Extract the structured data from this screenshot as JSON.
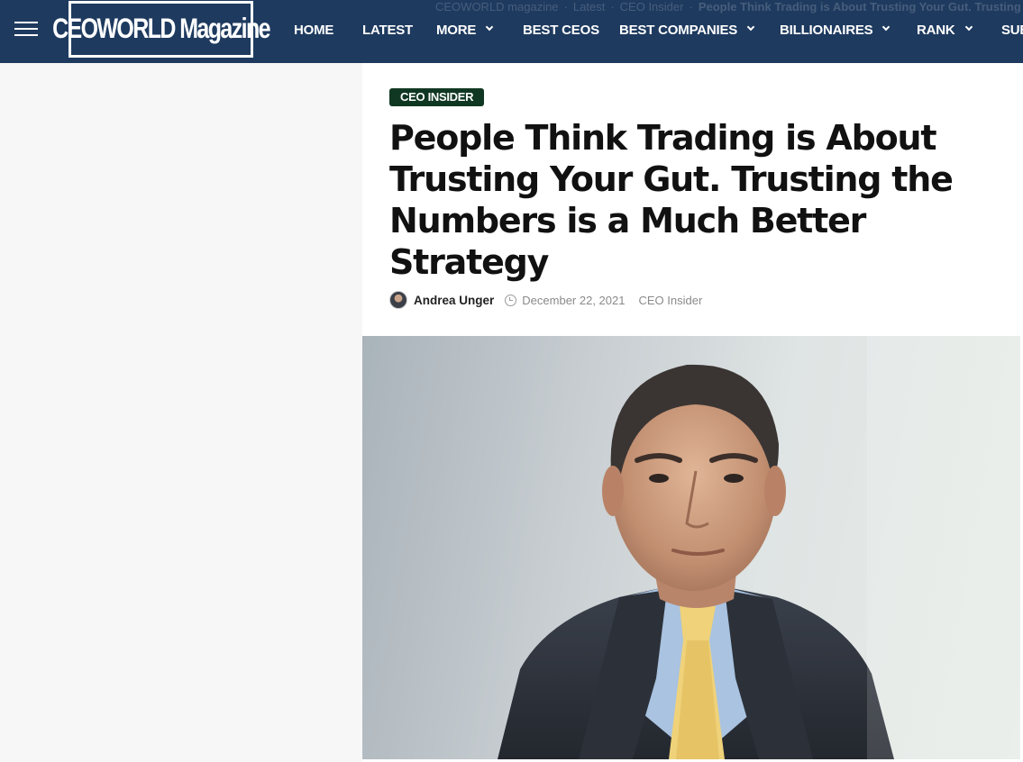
{
  "breadcrumb": {
    "items": [
      "CEOWORLD magazine",
      "Latest",
      "CEO Insider"
    ],
    "separator": "·",
    "current": "People Think Trading is About Trusting Your Gut. Trusting the Numbers is a Much Better Strategy"
  },
  "header": {
    "logo_text": "CEOWORLD Magazine",
    "nav": [
      {
        "label": "HOME",
        "has_dropdown": false
      },
      {
        "label": "LATEST",
        "has_dropdown": false
      },
      {
        "label": "MORE",
        "has_dropdown": true
      },
      {
        "label": "BEST CEOS",
        "has_dropdown": false
      },
      {
        "label": "BEST COMPANIES",
        "has_dropdown": true
      },
      {
        "label": "BILLIONAIRES",
        "has_dropdown": true
      },
      {
        "label": "RANK",
        "has_dropdown": true
      },
      {
        "label": "SUBSCRIBE",
        "has_dropdown": false
      }
    ]
  },
  "article": {
    "category_badge": "CEO INSIDER",
    "title": "People Think Trading is About Trusting Your Gut. Trusting the Numbers is a Much Better Strategy",
    "author": "Andrea Unger",
    "date": "December 22, 2021",
    "category": "CEO Insider"
  },
  "colors": {
    "navbar_bg": "#1e3a5f",
    "badge_bg": "#103722",
    "page_bg": "#f7f7f7"
  },
  "icons": [
    "hamburger-menu-icon",
    "chevron-down-icon",
    "clock-icon",
    "author-avatar"
  ]
}
